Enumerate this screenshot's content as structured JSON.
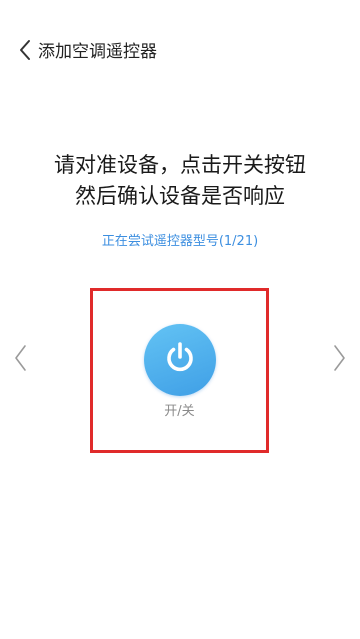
{
  "header": {
    "back_icon": "chevron-left-icon",
    "title": "添加空调遥控器"
  },
  "instruction": {
    "line1": "请对准设备，点击开关按钮",
    "line2": "然后确认设备是否响应"
  },
  "status": {
    "text": "正在尝试遥控器型号(1/21)"
  },
  "key": {
    "icon": "power-icon",
    "label": "开/关",
    "highlight_color": "#e02a2a",
    "button_color": "#4aaeea"
  },
  "nav": {
    "prev_icon": "chevron-left-icon",
    "next_icon": "chevron-right-icon"
  }
}
